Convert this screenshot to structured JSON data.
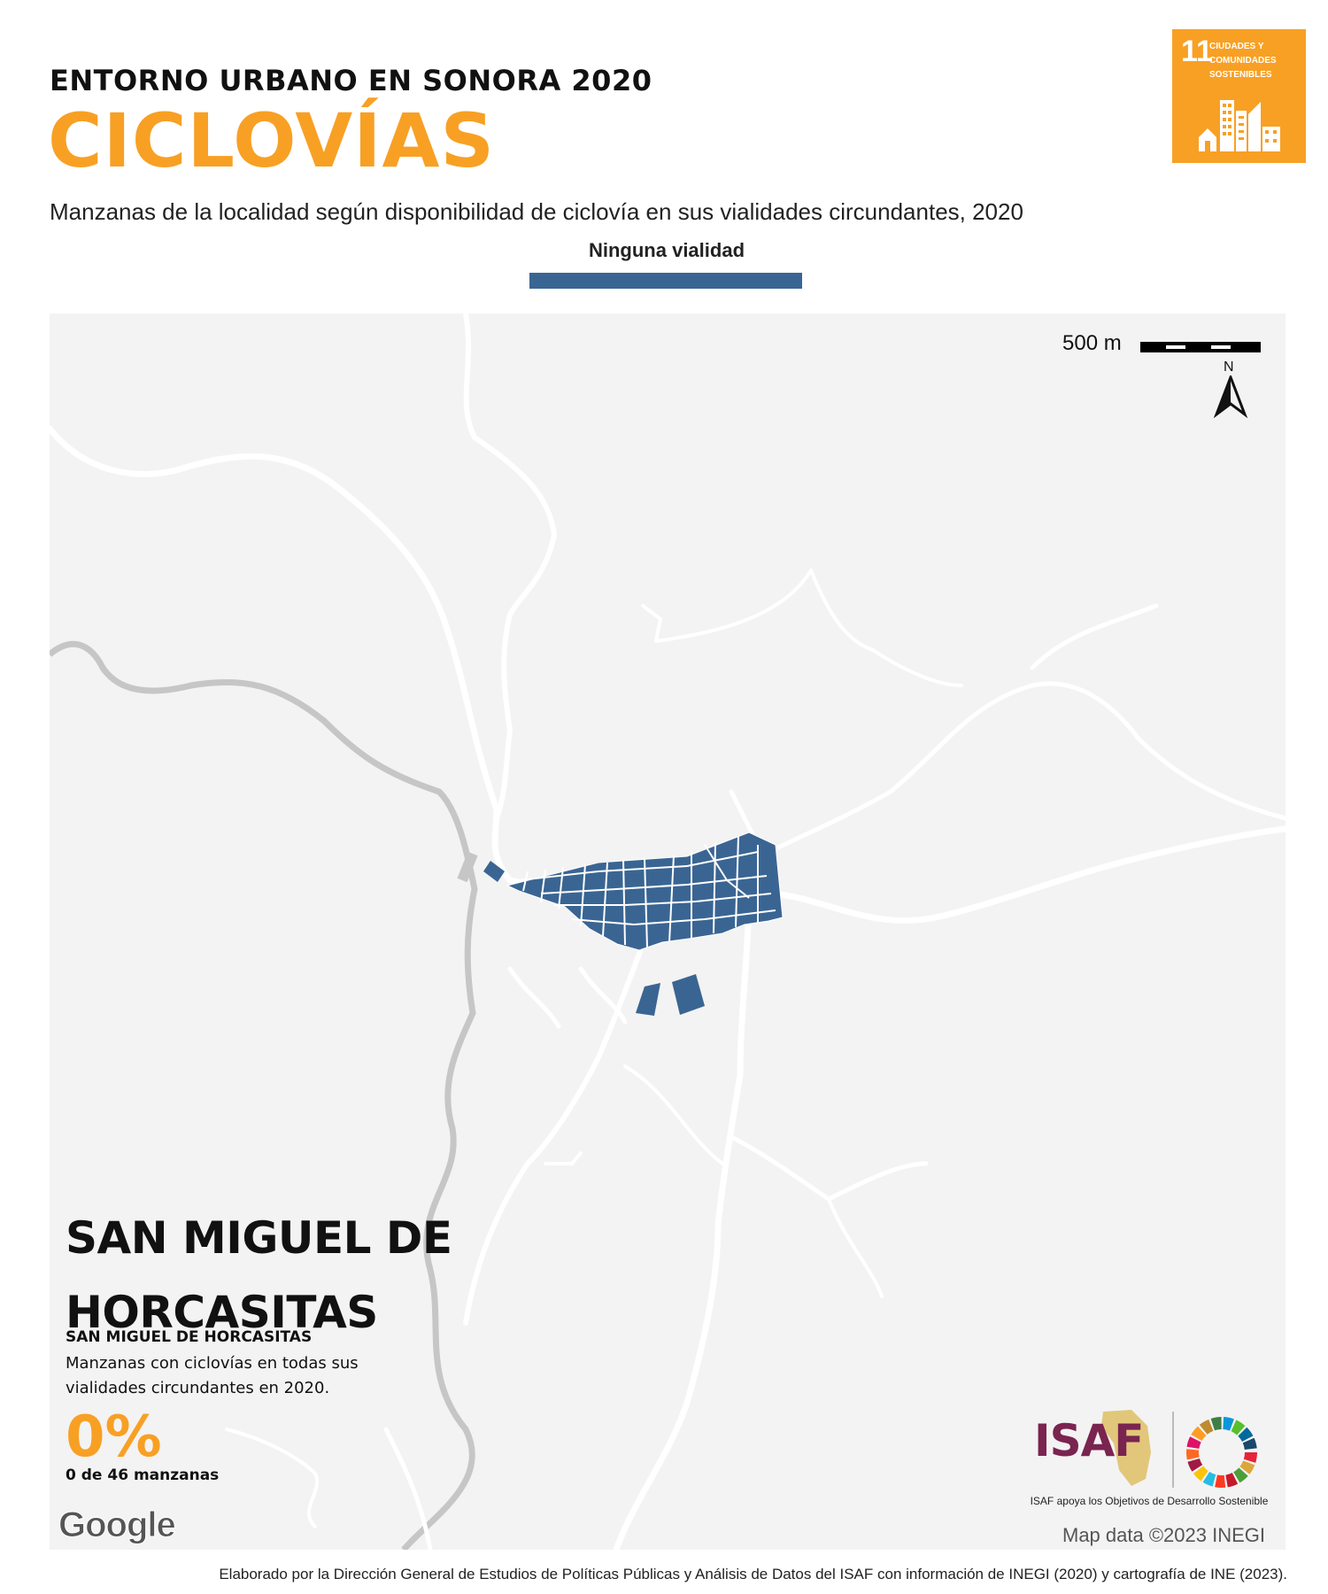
{
  "header": {
    "kicker": "ENTORNO URBANO EN SONORA 2020",
    "title": "CICLOVÍAS",
    "subtitle": "Manzanas de la localidad según disponibilidad de ciclovía en sus vialidades circundantes, 2020"
  },
  "legend": {
    "label": "Ninguna vialidad",
    "color": "#3a6593"
  },
  "sdg_badge": {
    "number": "11",
    "text_lines": [
      "CIUDADES Y",
      "COMUNIDADES",
      "SOSTENIBLES"
    ],
    "color": "#f8a024"
  },
  "map": {
    "scale_label": "500 m",
    "north_label": "N",
    "provider": "Google",
    "attribution": "Map data ©2023 INEGI",
    "block_color": "#3a6593",
    "background_color": "#f3f3f3"
  },
  "locality": {
    "title": "SAN MIGUEL DE HORCASITAS",
    "subtitle": "SAN MIGUEL DE HORCASITAS",
    "stat_description": "Manzanas con ciclovías en todas sus vialidades circundantes en 2020.",
    "stat_value": "0%",
    "stat_count": "0 de 46 manzanas"
  },
  "branding": {
    "org": "ISAF",
    "tagline": "ISAF apoya los Objetivos de Desarrollo Sostenible",
    "org_color": "#7a2450"
  },
  "footer": {
    "credit": "Elaborado por la Dirección General de Estudios de Políticas Públicas y Análisis de Datos del ISAF con información de INEGI (2020) y cartografía de INE (2023)."
  }
}
